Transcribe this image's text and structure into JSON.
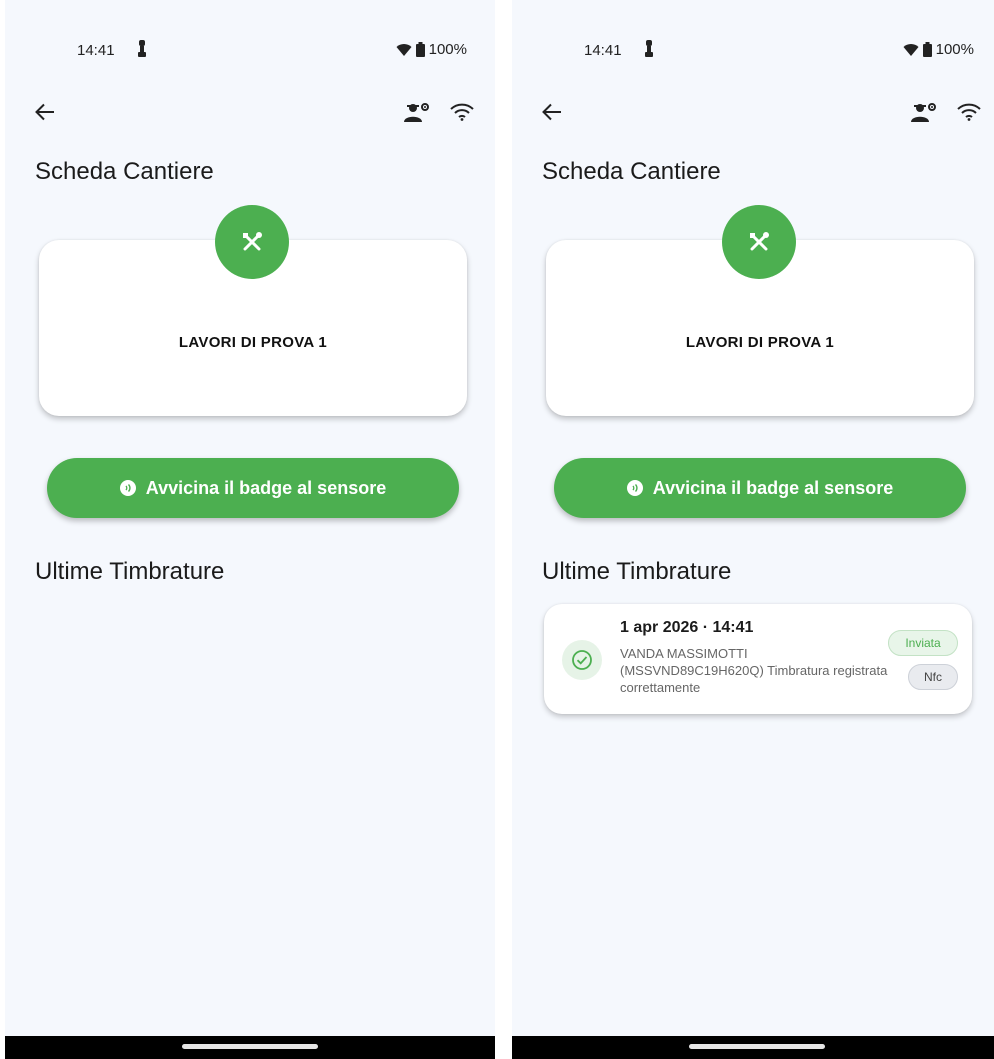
{
  "status_bar": {
    "time": "14:41",
    "battery": "100%"
  },
  "page": {
    "title": "Scheda Cantiere"
  },
  "site": {
    "name": "LAVORI DI PROVA 1",
    "avatar_icon": "tools-icon"
  },
  "badge_button": {
    "label": "Avvicina il badge al sensore",
    "icon": "nfc-icon"
  },
  "section": {
    "title": "Ultime Timbrature"
  },
  "stamps": [
    {
      "datetime": "1 apr 2026 · 14:41",
      "description": "VANDA MASSIMOTTI (MSSVND89C19H620Q) Timbratura registrata correttamente",
      "status": "Inviata",
      "method": "Nfc"
    }
  ],
  "colors": {
    "accent": "#4caf50",
    "background": "#f5f8fd",
    "card": "#ffffff"
  }
}
